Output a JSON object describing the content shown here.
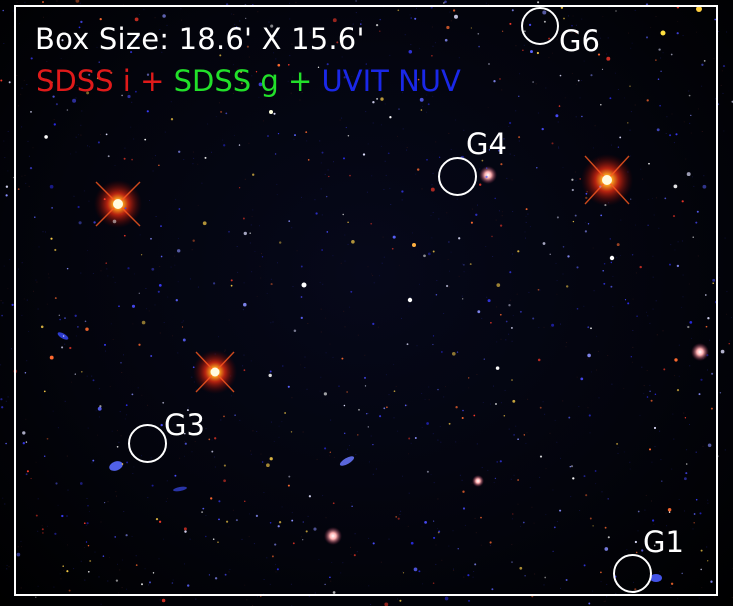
{
  "image": {
    "box_size_text": "Box Size: 18.6' X 15.6'",
    "legend": {
      "red": "SDSS i",
      "plus1": "+",
      "green": "SDSS g",
      "plus2": "+",
      "blue": "UVIT NUV"
    },
    "colors": {
      "red": "#e01a1a",
      "green": "#22e02a",
      "blue": "#1a28e8",
      "frame": "#ffffff"
    },
    "markers": [
      {
        "id": "g1",
        "label": "G1"
      },
      {
        "id": "g3",
        "label": "G3"
      },
      {
        "id": "g4",
        "label": "G4"
      },
      {
        "id": "g6",
        "label": "G6"
      }
    ]
  }
}
